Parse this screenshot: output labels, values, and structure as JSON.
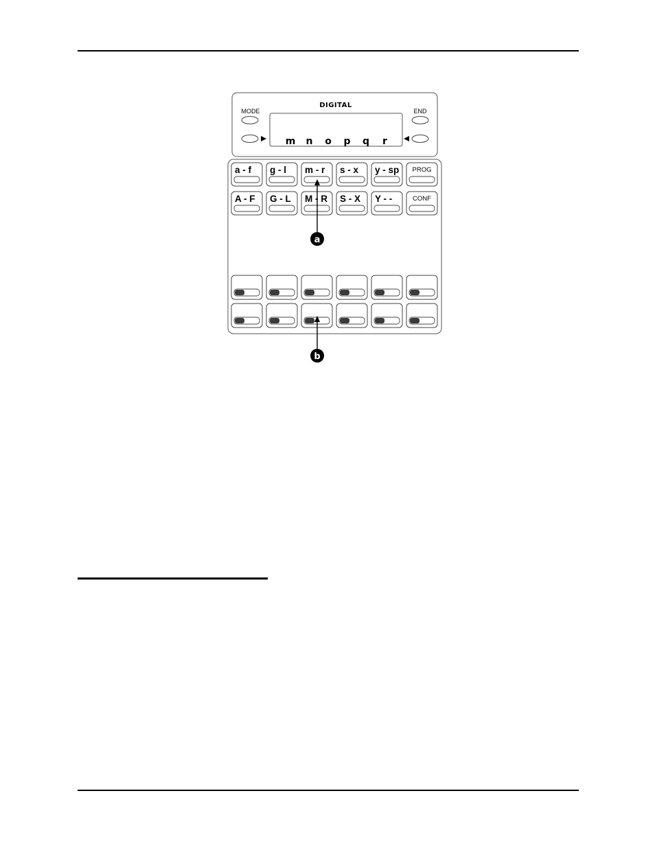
{
  "figure": {
    "brand_label": "DIGITAL",
    "mode_label": "MODE",
    "end_label": "END",
    "display_chars": [
      "m",
      "n",
      "o",
      "p",
      "q",
      "r"
    ],
    "keypad_row1": [
      {
        "label": "a - f",
        "style": "big"
      },
      {
        "label": "g - l",
        "style": "big"
      },
      {
        "label": "m - r",
        "style": "big"
      },
      {
        "label": "s - x",
        "style": "big"
      },
      {
        "label": "y - sp",
        "style": "big"
      },
      {
        "label": "PROG",
        "style": "small"
      }
    ],
    "keypad_row2": [
      {
        "label": "A - F",
        "style": "big"
      },
      {
        "label": "G - L",
        "style": "big"
      },
      {
        "label": "M - R",
        "style": "big"
      },
      {
        "label": "S - X",
        "style": "big"
      },
      {
        "label": "Y - -",
        "style": "big"
      },
      {
        "label": "CONF",
        "style": "small"
      }
    ],
    "lamp_rows": 2,
    "lamp_cols": 6,
    "callouts": [
      {
        "letter": "a",
        "target": "m - r key"
      },
      {
        "letter": "b",
        "target": "lamp key, row 2, column 3"
      }
    ]
  },
  "colors": {
    "ink": "#000000",
    "outline": "#555555",
    "lamp": "#3a3a3a",
    "background": "#ffffff"
  }
}
